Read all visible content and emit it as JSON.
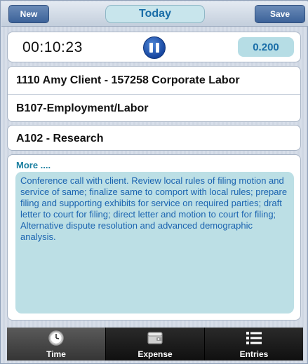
{
  "topbar": {
    "new_label": "New",
    "title": "Today",
    "save_label": "Save"
  },
  "timer": {
    "elapsed": "00:10:23",
    "hours": "0.200"
  },
  "entry": {
    "client_matter": "1110 Amy Client - 157258 Corporate Labor",
    "phase": "B107-Employment/Labor",
    "task": "A102 - Research"
  },
  "notes": {
    "more_label": "More ....",
    "text": "Conference call with client. Review local rules of filing motion and service of same; finalize same to comport with local rules; prepare filing and supporting exhibits for service on required parties; draft letter to court for filing; direct letter and motion to court for filing;  Alternative dispute resolution and advanced demographic analysis."
  },
  "tabs": [
    {
      "label": "Time",
      "icon": "clock-icon",
      "active": true
    },
    {
      "label": "Expense",
      "icon": "wallet-icon",
      "active": false
    },
    {
      "label": "Entries",
      "icon": "list-icon",
      "active": false
    }
  ],
  "colors": {
    "accent": "#1a6ea8",
    "button": "#3c6299",
    "notes_bg": "#bcdfe5"
  }
}
